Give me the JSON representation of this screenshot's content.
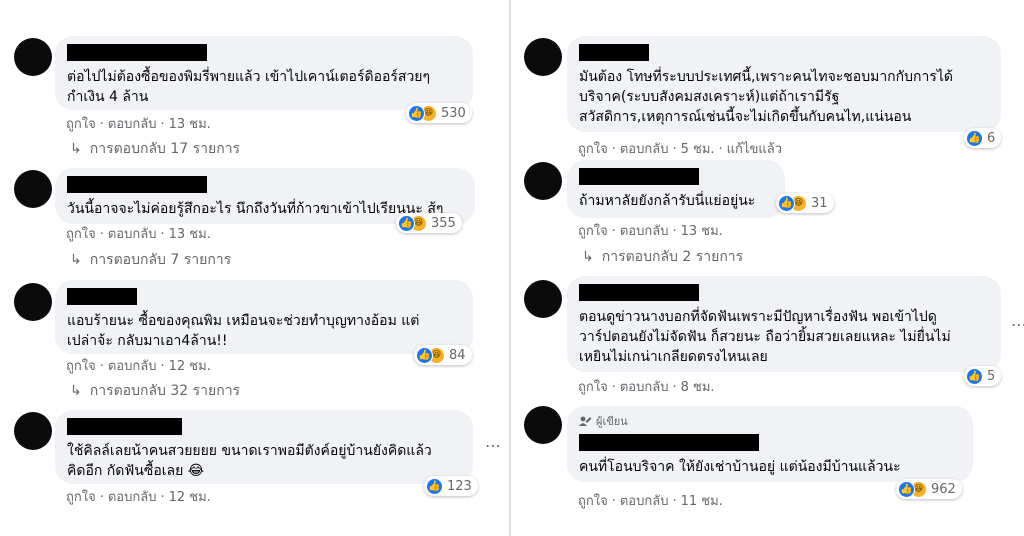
{
  "labels": {
    "like": "ถูกใจ",
    "reply": "ตอบกลับ",
    "edited": "แก้ไขแล้ว",
    "author_badge": "ผู้เขียน",
    "dot": "·"
  },
  "colors": {
    "bubble": "#f0f2f5",
    "like_blue": "#1877f2",
    "haha_yellow": "#f7b125",
    "meta_gray": "#65676b"
  },
  "left": [
    {
      "text": "ต่อไปไม่ต้องซื้อของพิมรี่พายแล้ว เข้าไปเคาน์เตอร์ดิออร์สวยๆ\nกำเงิน 4 ล้าน",
      "reactions": "530",
      "reaction_icons": [
        "like-icon",
        "haha-icon"
      ],
      "time": "13 ชม.",
      "replies": "การตอบกลับ 17 รายการ"
    },
    {
      "text": "วันนี้อาจจะไม่ค่อยรู้สึกอะไร นึกถึงวันที่ก้าวขาเข้าไปเรียนนะ สู้ๆ",
      "reactions": "355",
      "reaction_icons": [
        "like-icon",
        "haha-icon"
      ],
      "time": "13 ชม.",
      "replies": "การตอบกลับ 7 รายการ"
    },
    {
      "text": "แอบร้ายนะ ซื้อของคุณพิม เหมือนจะช่วยทำบุญทางอ้อม แต่\nเปล่าจ้ะ กลับมาเอา4ล้าน!!",
      "reactions": "84",
      "reaction_icons": [
        "like-icon",
        "haha-icon"
      ],
      "time": "12 ชม.",
      "replies": "การตอบกลับ 32 รายการ"
    },
    {
      "text": "ใช้คิลล์เลยน้าคนสวยยยย ขนาดเราพอมีตังค์อยู่บ้านยังคิดแล้ว\nคิดอีก กัดฟันซื้อเลย 😂",
      "reactions": "123",
      "reaction_icons": [
        "like-icon"
      ],
      "time": "12 ชม."
    }
  ],
  "right": [
    {
      "text": "มันต้อง โทษที่ระบบประเทศนี้,เพราะคนไทจะชอบมากกับการได้\nบริจาค(ระบบสังคมสงเคราะห์)แต่ถ้าเรามีรัฐ\nสวัสดิการ,เหตุการณ์เช่นนี้จะไม่เกิดขึ้นกับคนไท,แน่นอน",
      "reactions": "6",
      "reaction_icons": [
        "like-icon"
      ],
      "time": "5 ชม.",
      "edited": true
    },
    {
      "text": "ถ้ามหาลัยยังกล้ารับนี่แย่อยู่นะ",
      "reactions": "31",
      "reaction_icons": [
        "like-icon",
        "haha-icon"
      ],
      "time": "13 ชม.",
      "replies": "การตอบกลับ 2 รายการ"
    },
    {
      "text": "ตอนดูข่าวนางบอกที่จัดฟันเพราะมีปัญหาเรื่องฟัน พอเข้าไปดู\nวาร์ปตอนยังไม่จัดฟัน ก็สวยนะ ถือว่ายิ้มสวยเลยแหละ ไม่ยื่นไม่\nเหยินไม่เกน่าเกลียดตรงไหนเลย",
      "reactions": "5",
      "reaction_icons": [
        "like-icon"
      ],
      "time": "8 ชม."
    },
    {
      "text": "คนที่โอนบริจาค ให้ยังเช่าบ้านอยู่ แต่น้องมีบ้านแล้วนะ",
      "reactions": "962",
      "reaction_icons": [
        "like-icon",
        "haha-icon"
      ],
      "time": "11 ชม.",
      "author": true
    }
  ]
}
